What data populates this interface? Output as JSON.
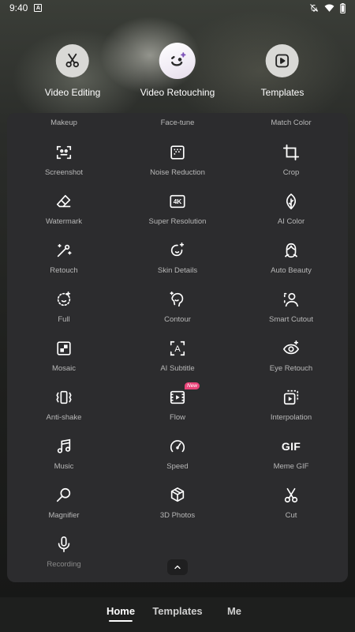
{
  "status_bar": {
    "time": "9:40",
    "notification_icon": "a-icon",
    "icons": [
      "bell-off-icon",
      "wifi-icon",
      "battery-icon"
    ]
  },
  "modes": [
    {
      "label": "Video Editing",
      "icon": "scissors-icon"
    },
    {
      "label": "Video Retouching",
      "icon": "wink-face-icon"
    },
    {
      "label": "Templates",
      "icon": "play-square-icon"
    }
  ],
  "partial_row": [
    "Makeup",
    "Face-tune",
    "Match Color"
  ],
  "tools": [
    {
      "label": "Screenshot",
      "icon": "screenshot-icon"
    },
    {
      "label": "Noise Reduction",
      "icon": "noise-reduction-icon"
    },
    {
      "label": "Crop",
      "icon": "crop-icon"
    },
    {
      "label": "Watermark",
      "icon": "eraser-icon"
    },
    {
      "label": "Super Resolution",
      "icon": "4k-icon",
      "icon_text": "4K"
    },
    {
      "label": "AI Color",
      "icon": "leaf-icon"
    },
    {
      "label": "Retouch",
      "icon": "magic-wand-icon"
    },
    {
      "label": "Skin Details",
      "icon": "sparkle-circle-icon"
    },
    {
      "label": "Auto Beauty",
      "icon": "face-portrait-icon"
    },
    {
      "label": "Full",
      "icon": "dotted-face-icon"
    },
    {
      "label": "Contour",
      "icon": "contour-icon"
    },
    {
      "label": "Smart Cutout",
      "icon": "person-cutout-icon"
    },
    {
      "label": "Mosaic",
      "icon": "mosaic-icon"
    },
    {
      "label": "AI Subtitle",
      "icon": "subtitle-icon",
      "icon_text": "A"
    },
    {
      "label": "Eye Retouch",
      "icon": "eye-icon"
    },
    {
      "label": "Anti-shake",
      "icon": "anti-shake-icon"
    },
    {
      "label": "Flow",
      "icon": "flow-icon",
      "badge": "New"
    },
    {
      "label": "Interpolation",
      "icon": "interpolation-icon"
    },
    {
      "label": "Music",
      "icon": "music-note-icon"
    },
    {
      "label": "Speed",
      "icon": "speedometer-icon"
    },
    {
      "label": "Meme GIF",
      "icon": "gif-icon",
      "icon_text": "GIF"
    },
    {
      "label": "Magnifier",
      "icon": "magnifier-icon"
    },
    {
      "label": "3D Photos",
      "icon": "cube-icon"
    },
    {
      "label": "Cut",
      "icon": "scissors-icon"
    },
    {
      "label": "Recording",
      "icon": "microphone-icon"
    }
  ],
  "bottom_nav": [
    {
      "label": "Home",
      "active": true
    },
    {
      "label": "Templates",
      "active": false
    },
    {
      "label": "Me",
      "active": false
    }
  ],
  "colors": {
    "panel": "#2c2c2e",
    "badge": "#e9457a",
    "label": "#b8b8b8"
  }
}
